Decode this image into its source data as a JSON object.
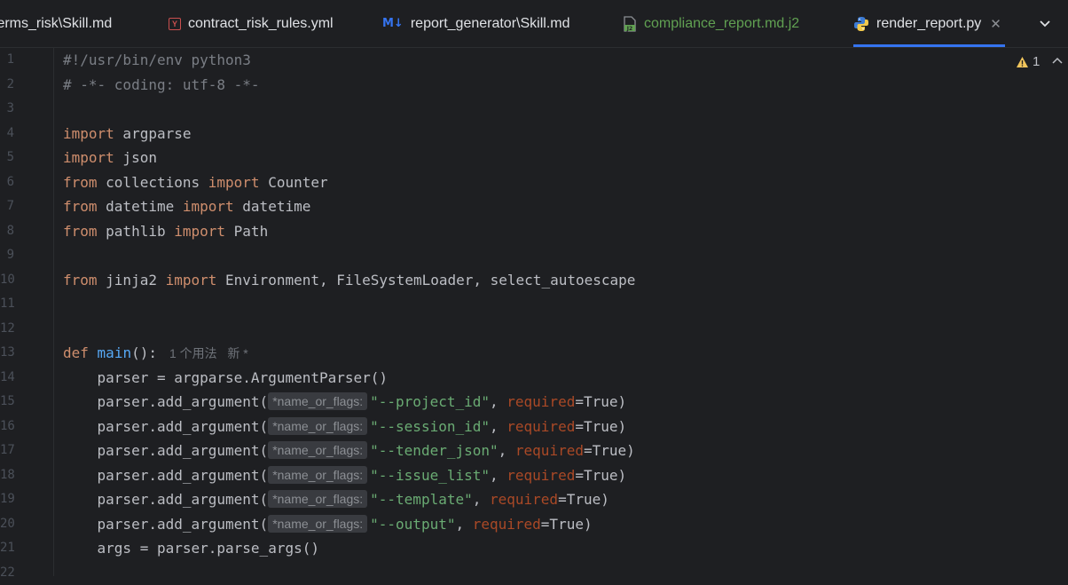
{
  "tabs": [
    {
      "label": "terms_risk\\Skill.md",
      "icon": "markdown-icon"
    },
    {
      "label": "contract_risk_rules.yml",
      "icon": "yaml-icon"
    },
    {
      "label": "report_generator\\Skill.md",
      "icon": "markdown-icon"
    },
    {
      "label": "compliance_report.md.j2",
      "icon": "jinja2-icon"
    },
    {
      "label": "render_report.py",
      "icon": "python-icon",
      "active": true
    }
  ],
  "md_icon_text": "M↓",
  "yml_icon_text": "Y",
  "warnings": {
    "count": "1"
  },
  "line_numbers": [
    "1",
    "2",
    "3",
    "4",
    "5",
    "6",
    "7",
    "8",
    "9",
    "10",
    "11",
    "12",
    "13",
    "14",
    "15",
    "16",
    "17",
    "18",
    "19",
    "20",
    "21",
    "22"
  ],
  "code": {
    "l1": "#!/usr/bin/env python3",
    "l2": "# -*- coding: utf-8 -*-",
    "import": "import",
    "from": "from",
    "def": "def",
    "argparse": " argparse",
    "json": " json",
    "collections": " collections ",
    "counter": " Counter",
    "datetime_mod": " datetime ",
    "datetime_cls": " datetime",
    "pathlib": " pathlib ",
    "path": " Path",
    "jinja2": " jinja2 ",
    "jinja2_names": " Environment, FileSystemLoader, select_autoescape",
    "main": "main",
    "main_sig": "():",
    "usage_hint": "1 个用法   新 *",
    "l14": "    parser = argparse.ArgumentParser()",
    "add_arg": "    parser.add_argument(",
    "param_hint": "*name_or_flags:",
    "required": "required",
    "eq_true": "=True)",
    "comma": ", ",
    "args_project": "\"--project_id\"",
    "args_session": "\"--session_id\"",
    "args_tender": "\"--tender_json\"",
    "args_issue": "\"--issue_list\"",
    "args_template": "\"--template\"",
    "args_output": "\"--output\"",
    "l21": "    args = parser.parse_args()"
  },
  "colors": {
    "accent": "#3574f0",
    "keyword": "#cf8e6d",
    "function": "#56a8f5",
    "string": "#6aab73",
    "named_arg": "#aa4926"
  }
}
